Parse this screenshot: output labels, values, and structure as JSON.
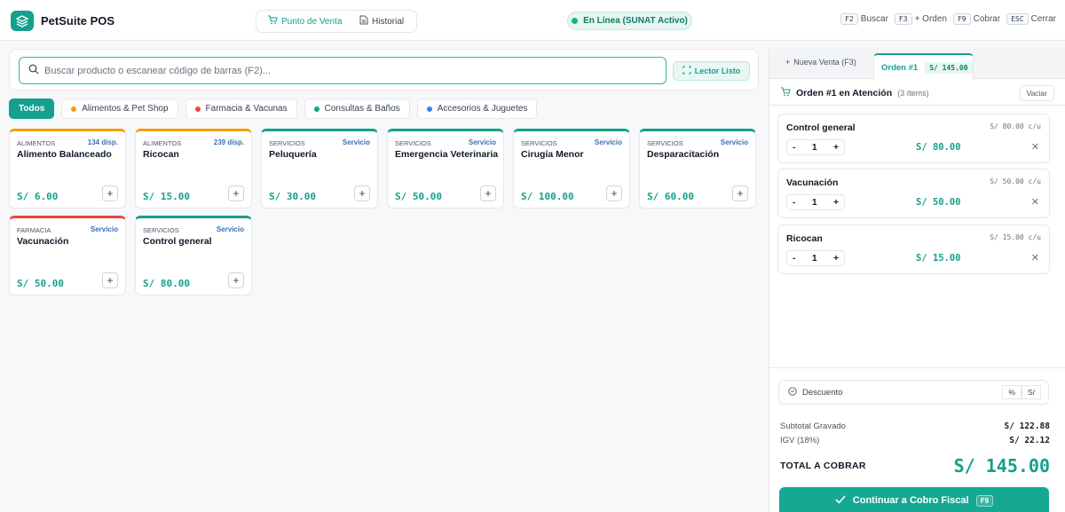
{
  "header": {
    "app_title": "PetSuite POS",
    "nav": [
      {
        "label": "Punto de Venta",
        "icon": "cart-icon",
        "active": true
      },
      {
        "label": "Historial",
        "icon": "document-icon",
        "active": false
      }
    ],
    "status": "En Línea (SUNAT Activo)",
    "shortcuts": [
      {
        "key": "F2",
        "label": "Buscar"
      },
      {
        "key": "F3",
        "label": "+ Orden"
      },
      {
        "key": "F9",
        "label": "Cobrar"
      },
      {
        "key": "ESC",
        "label": "Cerrar"
      }
    ]
  },
  "search": {
    "placeholder": "Buscar producto o escanear código de barras (F2)...",
    "scanner_label": "Lector Listo"
  },
  "categories": [
    {
      "label": "Todos",
      "active": true
    },
    {
      "label": "Alimentos & Pet Shop",
      "dot_color": "#f59e0b"
    },
    {
      "label": "Farmacia & Vacunas",
      "dot_color": "#ef4444"
    },
    {
      "label": "Consultas & Baños",
      "dot_color": "#14a08c"
    },
    {
      "label": "Accesorios & Juguetes",
      "dot_color": "#3b82f6"
    }
  ],
  "products": [
    {
      "category": "ALIMENTOS",
      "stock": "134 disp.",
      "name": "Alimento Balanceado",
      "price": "S/ 6.00",
      "accent": "#f59e0b"
    },
    {
      "category": "ALIMENTOS",
      "stock": "239 disp.",
      "name": "Ricocan",
      "price": "S/ 15.00",
      "accent": "#f59e0b"
    },
    {
      "category": "SERVICIOS",
      "stock": "Servicio",
      "name": "Peluquería",
      "price": "S/ 30.00",
      "accent": "#14a08c"
    },
    {
      "category": "SERVICIOS",
      "stock": "Servicio",
      "name": "Emergencia Veterinaria",
      "price": "S/ 50.00",
      "accent": "#14a08c"
    },
    {
      "category": "SERVICIOS",
      "stock": "Servicio",
      "name": "Cirugía Menor",
      "price": "S/ 100.00",
      "accent": "#14a08c"
    },
    {
      "category": "SERVICIOS",
      "stock": "Servicio",
      "name": "Desparacitación",
      "price": "S/ 60.00",
      "accent": "#14a08c"
    },
    {
      "category": "FARMACIA",
      "stock": "Servicio",
      "name": "Vacunación",
      "price": "S/ 50.00",
      "accent": "#ef4444"
    },
    {
      "category": "SERVICIOS",
      "stock": "Servicio",
      "name": "Control general",
      "price": "S/ 80.00",
      "accent": "#14a08c"
    }
  ],
  "order": {
    "new_tab_label": "Nueva Venta (F3)",
    "tab_label": "Orden #1",
    "tab_total": "S/ 145.00",
    "title": "Orden #1 en Atención",
    "count": "(3 ítems)",
    "clear_label": "Vaciar",
    "items": [
      {
        "name": "Control general",
        "unit": "S/ 80.00 c/u",
        "qty": "1",
        "total": "S/ 80.00"
      },
      {
        "name": "Vacunación",
        "unit": "S/ 50.00 c/u",
        "qty": "1",
        "total": "S/ 50.00"
      },
      {
        "name": "Ricocan",
        "unit": "S/ 15.00 c/u",
        "qty": "1",
        "total": "S/ 15.00"
      }
    ],
    "discount_label": "Descuento",
    "discount_modes": [
      "%",
      "S/"
    ],
    "subtotal_label": "Subtotal Gravado",
    "subtotal": "S/ 122.88",
    "igv_label": "IGV (18%)",
    "igv": "S/ 22.12",
    "total_label": "TOTAL A COBRAR",
    "total": "S/ 145.00",
    "cta_label": "Continuar a Cobro Fiscal",
    "cta_key": "F9"
  }
}
